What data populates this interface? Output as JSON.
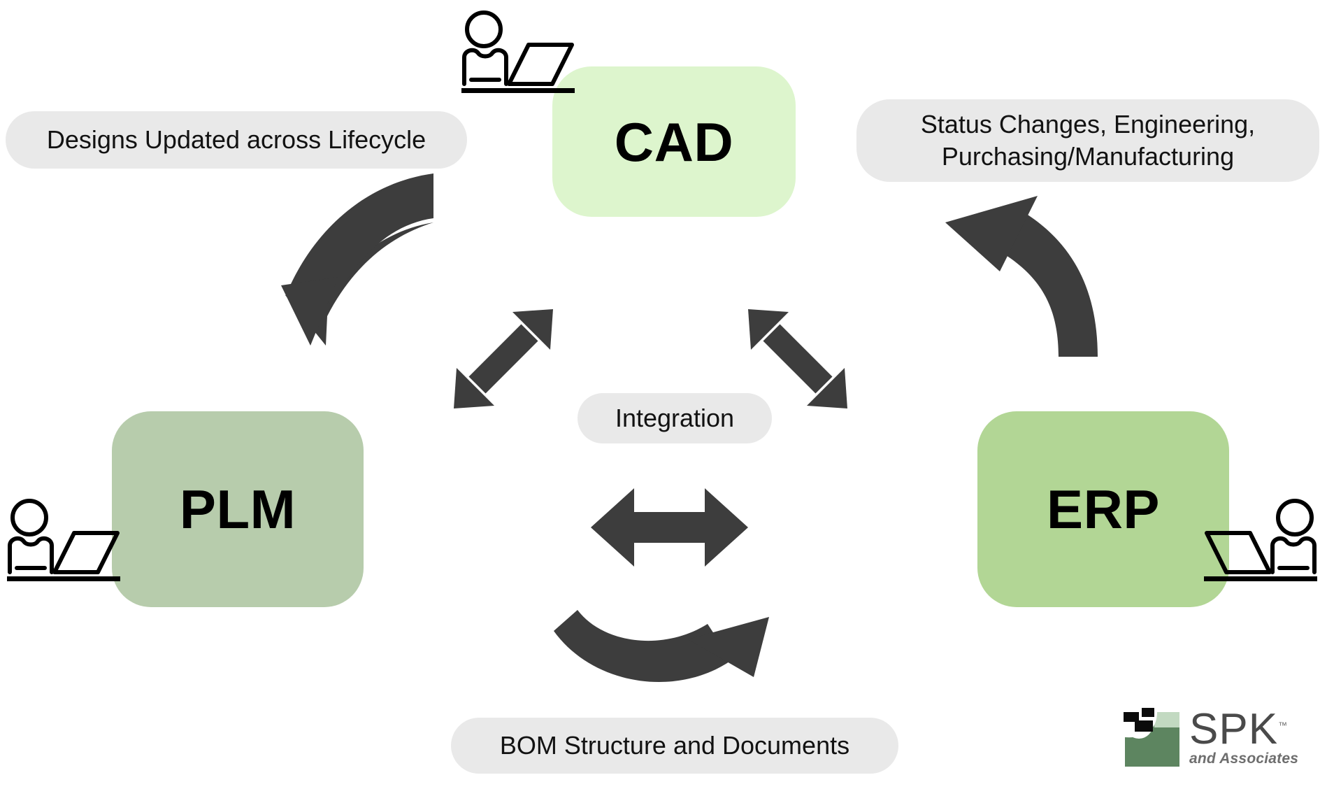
{
  "diagram": {
    "title": "CAD PLM ERP Integration",
    "background_color": "#ffffff",
    "arrow_color": "#3d3d3d",
    "pill_color": "#e9e9e9"
  },
  "systems": [
    {
      "id": "cad",
      "label": "CAD",
      "color": "#ddf5cd"
    },
    {
      "id": "plm",
      "label": "PLM",
      "color": "#b7ccac"
    },
    {
      "id": "erp",
      "label": "ERP",
      "color": "#b2d695"
    }
  ],
  "labels": {
    "left": "Designs Updated across Lifecycle",
    "right_line1": "Status Changes, Engineering,",
    "right_line2": "Purchasing/Manufacturing",
    "center": "Integration",
    "bottom": "BOM Structure and Documents"
  },
  "icons": {
    "person_cad": "person-at-laptop-icon",
    "person_plm": "person-at-laptop-icon",
    "person_erp": "person-at-laptop-icon",
    "arrow_curve_left": "curved-arrow-down-left-icon",
    "arrow_curve_right": "curved-arrow-up-left-icon",
    "arrow_diag_left": "double-headed-diagonal-arrow-icon",
    "arrow_diag_right": "double-headed-diagonal-arrow-icon",
    "arrow_horizontal": "double-headed-horizontal-arrow-icon",
    "arrow_curve_bottom": "curved-arrow-up-right-icon"
  },
  "logo": {
    "name": "SPK",
    "trademark": "™",
    "tagline": "and Associates",
    "mark_color_dark": "#5d8560",
    "mark_color_light": "#c2d9c1"
  }
}
